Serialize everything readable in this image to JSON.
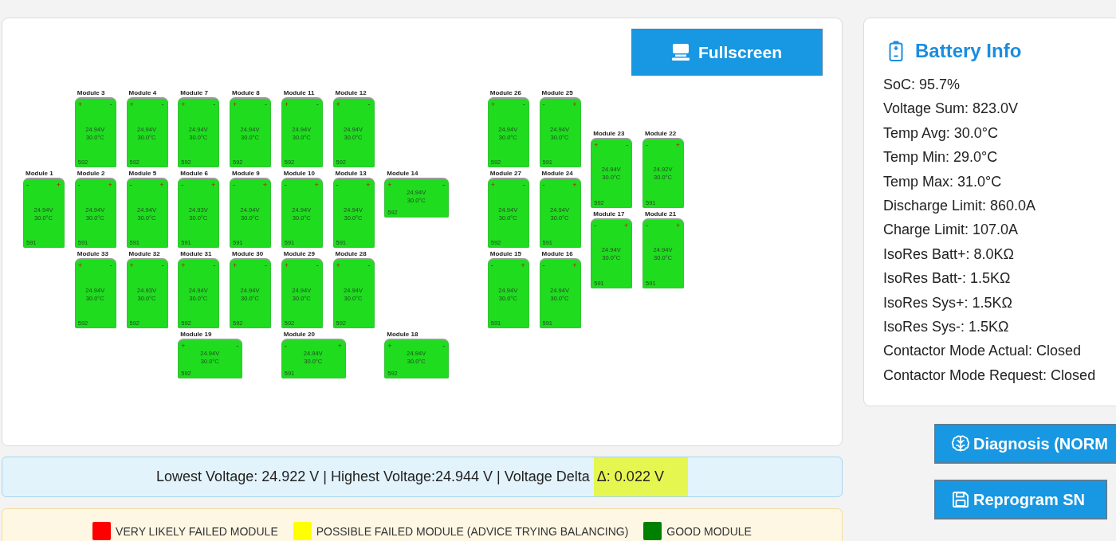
{
  "pack_view": {
    "fullscreen_button": "Fullscreen",
    "modules": [
      {
        "name": "Module 3",
        "kind": "tall",
        "color": "#1fdc1f",
        "terminals": [
          {
            "sign": "+",
            "kind": "positive"
          },
          {
            "sign": "-",
            "kind": "negative"
          }
        ],
        "voltage": "24.94V",
        "temperature": "30.0°C",
        "code": "592"
      },
      {
        "name": "Module 4",
        "kind": "tall",
        "color": "#1fdc1f",
        "terminals": [
          {
            "sign": "+",
            "kind": "positive"
          },
          {
            "sign": "-",
            "kind": "negative"
          }
        ],
        "voltage": "24.94V",
        "temperature": "30.0°C",
        "code": "592"
      },
      {
        "name": "Module 7",
        "kind": "tall",
        "color": "#1fdc1f",
        "terminals": [
          {
            "sign": "+",
            "kind": "positive"
          },
          {
            "sign": "-",
            "kind": "negative"
          }
        ],
        "voltage": "24.94V",
        "temperature": "30.0°C",
        "code": "592"
      },
      {
        "name": "Module 8",
        "kind": "tall",
        "color": "#1fdc1f",
        "terminals": [
          {
            "sign": "+",
            "kind": "positive"
          },
          {
            "sign": "-",
            "kind": "negative"
          }
        ],
        "voltage": "24.94V",
        "temperature": "30.0°C",
        "code": "592"
      },
      {
        "name": "Module 11",
        "kind": "tall",
        "color": "#1fdc1f",
        "terminals": [
          {
            "sign": "+",
            "kind": "positive"
          },
          {
            "sign": "-",
            "kind": "negative"
          }
        ],
        "voltage": "24.94V",
        "temperature": "30.0°C",
        "code": "592"
      },
      {
        "name": "Module 12",
        "kind": "tall",
        "color": "#1fdc1f",
        "terminals": [
          {
            "sign": "+",
            "kind": "positive"
          },
          {
            "sign": "-",
            "kind": "negative"
          }
        ],
        "voltage": "24.94V",
        "temperature": "30.0°C",
        "code": "592"
      },
      {
        "name": "Module 26",
        "kind": "tall",
        "color": "#1fdc1f",
        "terminals": [
          {
            "sign": "+",
            "kind": "positive"
          },
          {
            "sign": "-",
            "kind": "negative"
          }
        ],
        "voltage": "24.94V",
        "temperature": "30.0°C",
        "code": "592"
      },
      {
        "name": "Module 25",
        "kind": "tall",
        "color": "#1fdc1f",
        "terminals": [
          {
            "sign": "-",
            "kind": "negative"
          },
          {
            "sign": "+",
            "kind": "positive"
          }
        ],
        "voltage": "24.94V",
        "temperature": "30.0°C",
        "code": "591"
      },
      {
        "name": "Module 23",
        "kind": "tall",
        "color": "#1fdc1f",
        "terminals": [
          {
            "sign": "+",
            "kind": "positive"
          },
          {
            "sign": "-",
            "kind": "negative"
          }
        ],
        "voltage": "24.94V",
        "temperature": "30.0°C",
        "code": "592"
      },
      {
        "name": "Module 22",
        "kind": "tall",
        "color": "#1fdc1f",
        "terminals": [
          {
            "sign": "-",
            "kind": "negative"
          },
          {
            "sign": "+",
            "kind": "positive"
          }
        ],
        "voltage": "24.92V",
        "temperature": "30.0°C",
        "code": "591"
      },
      {
        "name": "Module 1",
        "kind": "tall",
        "color": "#1fdc1f",
        "terminals": [
          {
            "sign": "-",
            "kind": "negative"
          },
          {
            "sign": "+",
            "kind": "positive"
          }
        ],
        "voltage": "24.94V",
        "temperature": "30.0°C",
        "code": "591"
      },
      {
        "name": "Module 2",
        "kind": "tall",
        "color": "#1fdc1f",
        "terminals": [
          {
            "sign": "-",
            "kind": "negative"
          },
          {
            "sign": "+",
            "kind": "positive"
          }
        ],
        "voltage": "24.94V",
        "temperature": "30.0°C",
        "code": "591"
      },
      {
        "name": "Module 5",
        "kind": "tall",
        "color": "#1fdc1f",
        "terminals": [
          {
            "sign": "-",
            "kind": "negative"
          },
          {
            "sign": "+",
            "kind": "positive"
          }
        ],
        "voltage": "24.94V",
        "temperature": "30.0°C",
        "code": "591"
      },
      {
        "name": "Module 6",
        "kind": "tall",
        "color": "#1fdc1f",
        "terminals": [
          {
            "sign": "-",
            "kind": "negative"
          },
          {
            "sign": "+",
            "kind": "positive"
          }
        ],
        "voltage": "24.93V",
        "temperature": "30.0°C",
        "code": "591"
      },
      {
        "name": "Module 9",
        "kind": "tall",
        "color": "#1fdc1f",
        "terminals": [
          {
            "sign": "-",
            "kind": "negative"
          },
          {
            "sign": "+",
            "kind": "positive"
          }
        ],
        "voltage": "24.94V",
        "temperature": "30.0°C",
        "code": "591"
      },
      {
        "name": "Module 10",
        "kind": "tall",
        "color": "#1fdc1f",
        "terminals": [
          {
            "sign": "-",
            "kind": "negative"
          },
          {
            "sign": "+",
            "kind": "positive"
          }
        ],
        "voltage": "24.94V",
        "temperature": "30.0°C",
        "code": "591"
      },
      {
        "name": "Module 13",
        "kind": "tall",
        "color": "#1fdc1f",
        "terminals": [
          {
            "sign": "-",
            "kind": "negative"
          },
          {
            "sign": "+",
            "kind": "positive"
          }
        ],
        "voltage": "24.94V",
        "temperature": "30.0°C",
        "code": "591"
      },
      {
        "name": "Module 14",
        "kind": "wide",
        "color": "#1fdc1f",
        "terminals": [
          {
            "sign": "+",
            "kind": "positive"
          },
          {
            "sign": "-",
            "kind": "negative"
          }
        ],
        "voltage": "24.94V",
        "temperature": "30.0°C",
        "code": "592"
      },
      {
        "name": "Module 27",
        "kind": "tall",
        "color": "#1fdc1f",
        "terminals": [
          {
            "sign": "+",
            "kind": "positive"
          },
          {
            "sign": "-",
            "kind": "negative"
          }
        ],
        "voltage": "24.94V",
        "temperature": "30.0°C",
        "code": "592"
      },
      {
        "name": "Module 24",
        "kind": "tall",
        "color": "#1fdc1f",
        "terminals": [
          {
            "sign": "-",
            "kind": "negative"
          },
          {
            "sign": "+",
            "kind": "positive"
          }
        ],
        "voltage": "24.94V",
        "temperature": "30.0°C",
        "code": "591"
      },
      {
        "name": "Module 17",
        "kind": "tall",
        "color": "#1fdc1f",
        "terminals": [
          {
            "sign": "-",
            "kind": "negative"
          },
          {
            "sign": "+",
            "kind": "positive"
          }
        ],
        "voltage": "24.94V",
        "temperature": "30.0°C",
        "code": "591"
      },
      {
        "name": "Module 21",
        "kind": "tall",
        "color": "#1fdc1f",
        "terminals": [
          {
            "sign": "-",
            "kind": "negative"
          },
          {
            "sign": "+",
            "kind": "positive"
          }
        ],
        "voltage": "24.94V",
        "temperature": "30.0°C",
        "code": "591"
      },
      {
        "name": "Module 33",
        "kind": "tall",
        "color": "#1fdc1f",
        "terminals": [
          {
            "sign": "+",
            "kind": "positive"
          },
          {
            "sign": "-",
            "kind": "negative"
          }
        ],
        "voltage": "24.94V",
        "temperature": "30.0°C",
        "code": "592"
      },
      {
        "name": "Module 32",
        "kind": "tall",
        "color": "#1fdc1f",
        "terminals": [
          {
            "sign": "+",
            "kind": "positive"
          },
          {
            "sign": "-",
            "kind": "negative"
          }
        ],
        "voltage": "24.93V",
        "temperature": "30.0°C",
        "code": "592"
      },
      {
        "name": "Module 31",
        "kind": "tall",
        "color": "#1fdc1f",
        "terminals": [
          {
            "sign": "+",
            "kind": "positive"
          },
          {
            "sign": "-",
            "kind": "negative"
          }
        ],
        "voltage": "24.94V",
        "temperature": "30.0°C",
        "code": "592"
      },
      {
        "name": "Module 30",
        "kind": "tall",
        "color": "#1fdc1f",
        "terminals": [
          {
            "sign": "+",
            "kind": "positive"
          },
          {
            "sign": "-",
            "kind": "negative"
          }
        ],
        "voltage": "24.94V",
        "temperature": "30.0°C",
        "code": "592"
      },
      {
        "name": "Module 29",
        "kind": "tall",
        "color": "#1fdc1f",
        "terminals": [
          {
            "sign": "+",
            "kind": "positive"
          },
          {
            "sign": "-",
            "kind": "negative"
          }
        ],
        "voltage": "24.94V",
        "temperature": "30.0°C",
        "code": "592"
      },
      {
        "name": "Module 28",
        "kind": "tall",
        "color": "#1fdc1f",
        "terminals": [
          {
            "sign": "+",
            "kind": "positive"
          },
          {
            "sign": "-",
            "kind": "negative"
          }
        ],
        "voltage": "24.94V",
        "temperature": "30.0°C",
        "code": "592"
      },
      {
        "name": "Module 15",
        "kind": "tall",
        "color": "#1fdc1f",
        "terminals": [
          {
            "sign": "-",
            "kind": "negative"
          },
          {
            "sign": "+",
            "kind": "positive"
          }
        ],
        "voltage": "24.94V",
        "temperature": "30.0°C",
        "code": "591"
      },
      {
        "name": "Module 16",
        "kind": "tall",
        "color": "#1fdc1f",
        "terminals": [
          {
            "sign": "-",
            "kind": "negative"
          },
          {
            "sign": "+",
            "kind": "positive"
          }
        ],
        "voltage": "24.94V",
        "temperature": "30.0°C",
        "code": "591"
      },
      {
        "name": "Module 19",
        "kind": "wide",
        "color": "#1fdc1f",
        "terminals": [
          {
            "sign": "+",
            "kind": "positive"
          },
          {
            "sign": "-",
            "kind": "negative"
          }
        ],
        "voltage": "24.94V",
        "temperature": "30.0°C",
        "code": "592"
      },
      {
        "name": "Module 20",
        "kind": "wide",
        "color": "#1fdc1f",
        "terminals": [
          {
            "sign": "-",
            "kind": "negative"
          },
          {
            "sign": "+",
            "kind": "positive"
          }
        ],
        "voltage": "24.94V",
        "temperature": "30.0°C",
        "code": "591"
      },
      {
        "name": "Module 18",
        "kind": "wide",
        "color": "#1fdc1f",
        "terminals": [
          {
            "sign": "+",
            "kind": "positive"
          },
          {
            "sign": "-",
            "kind": "negative"
          }
        ],
        "voltage": "24.94V",
        "temperature": "30.0°C",
        "code": "592"
      }
    ]
  },
  "voltage_summary": {
    "text": "Lowest Voltage: 24.922 V | Highest Voltage:24.944 V | Voltage Delta",
    "delta": "Δ: 0.022 V",
    "delta_highlighted": true
  },
  "legend": [
    {
      "label": "VERY LIKELY FAILED MODULE",
      "color": "#ff0000"
    },
    {
      "label": "POSSIBLE FAILED MODULE (ADVICE TRYING BALANCING)",
      "color": "#ffff00"
    },
    {
      "label": "GOOD MODULE",
      "color": "#008000"
    }
  ],
  "battery_info": {
    "title": "Battery Info",
    "lines": [
      "SoC: 95.7%",
      "Voltage Sum: 823.0V",
      "Temp Avg: 30.0°C",
      "Temp Min: 29.0°C",
      "Temp Max: 31.0°C",
      "Discharge Limit: 860.0A",
      "Charge Limit: 107.0A",
      "IsoRes Batt+: 8.0KΩ",
      "IsoRes Batt-: 1.5KΩ",
      "IsoRes Sys+: 1.5KΩ",
      "IsoRes Sys-: 1.5KΩ",
      "Contactor Mode Actual: Closed",
      "Contactor Mode Request: Closed"
    ]
  },
  "actions": [
    {
      "label": "Diagnosis (NORM",
      "kind": "diagnosis"
    },
    {
      "label": "Reprogram SN",
      "kind": "save"
    }
  ]
}
